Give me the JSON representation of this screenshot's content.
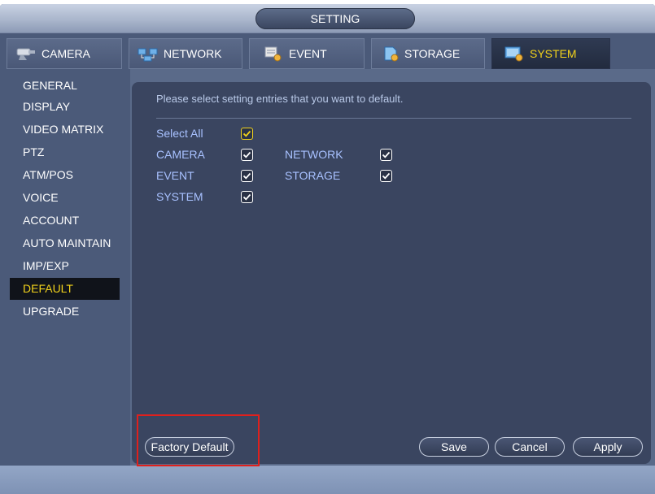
{
  "window": {
    "title": "SETTING"
  },
  "tabs": [
    {
      "label": "CAMERA",
      "icon": "camera-icon"
    },
    {
      "label": "NETWORK",
      "icon": "network-icon"
    },
    {
      "label": "EVENT",
      "icon": "event-icon"
    },
    {
      "label": "STORAGE",
      "icon": "storage-icon"
    },
    {
      "label": "SYSTEM",
      "icon": "system-icon",
      "active": true
    }
  ],
  "sidebar": {
    "items": [
      {
        "label": "GENERAL"
      },
      {
        "label": "DISPLAY"
      },
      {
        "label": "VIDEO MATRIX"
      },
      {
        "label": "PTZ"
      },
      {
        "label": "ATM/POS"
      },
      {
        "label": "VOICE"
      },
      {
        "label": "ACCOUNT"
      },
      {
        "label": "AUTO MAINTAIN"
      },
      {
        "label": "IMP/EXP"
      },
      {
        "label": "DEFAULT",
        "active": true
      },
      {
        "label": "UPGRADE"
      }
    ]
  },
  "main": {
    "hint": "Please select setting entries that you want to default.",
    "select_all": {
      "label": "Select All",
      "checked": true
    },
    "options": [
      {
        "label": "CAMERA",
        "checked": true
      },
      {
        "label": "NETWORK",
        "checked": true
      },
      {
        "label": "EVENT",
        "checked": true
      },
      {
        "label": "STORAGE",
        "checked": true
      },
      {
        "label": "SYSTEM",
        "checked": true
      }
    ],
    "buttons": {
      "factory_default": "Factory Default",
      "save": "Save",
      "cancel": "Cancel",
      "apply": "Apply"
    }
  },
  "colors": {
    "active_text": "#f2d21b",
    "option_text": "#a8c1ff",
    "highlight_border": "#e0201c"
  }
}
